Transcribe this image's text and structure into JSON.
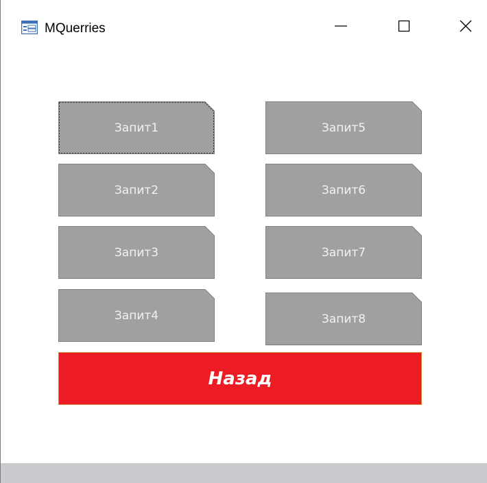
{
  "window": {
    "title": "MQuerries",
    "app_icon": "form-icon",
    "controls": {
      "minimize_icon": "minimize-icon",
      "maximize_icon": "maximize-icon",
      "close_icon": "close-icon"
    }
  },
  "buttons": {
    "left_column": [
      {
        "label": "Запит1",
        "focused": true
      },
      {
        "label": "Запит2"
      },
      {
        "label": "Запит3"
      },
      {
        "label": "Запит4"
      }
    ],
    "right_column": [
      {
        "label": "Запит5"
      },
      {
        "label": "Запит6"
      },
      {
        "label": "Запит7"
      },
      {
        "label": "Запит8"
      }
    ],
    "back": {
      "label": "Назад"
    }
  },
  "colors": {
    "tile_fill": "#a0a0a0",
    "tile_border": "#7f7f7f",
    "back_fill": "#ed1c24",
    "statusbar": "#c9cacd"
  }
}
